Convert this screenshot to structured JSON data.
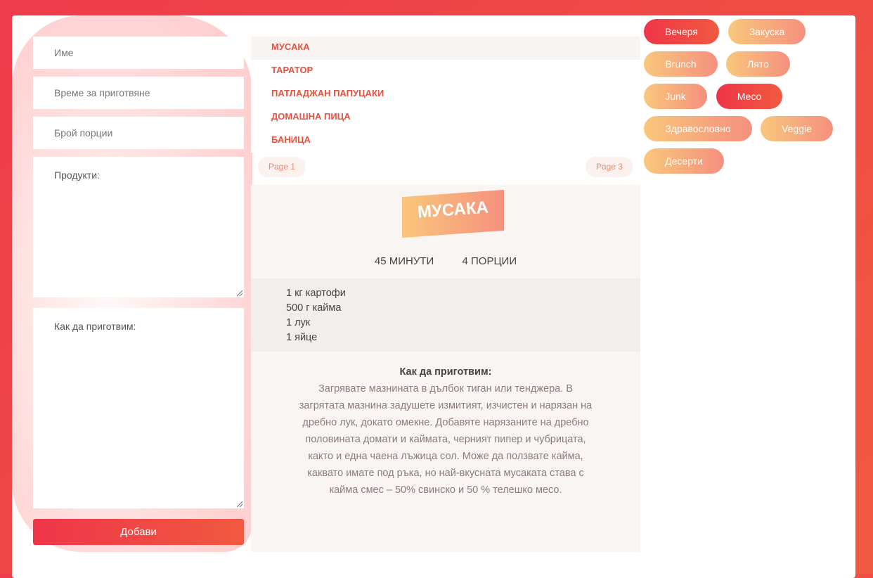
{
  "form": {
    "name_placeholder": "Име",
    "time_placeholder": "Време за приготвяне",
    "portions_placeholder": "Брой порции",
    "products_placeholder": "Продукти:",
    "howto_placeholder": "Как да приготвим:",
    "submit_label": "Добави"
  },
  "recipes": {
    "items": [
      "МУСАКА",
      "ТАРАТОР",
      "ПАТЛАДЖАН ПАПУЦАКИ",
      "ДОМАШНА ПИЦА",
      "БАНИЦА"
    ],
    "active_index": 0
  },
  "pager": {
    "prev_label": "Page 1",
    "next_label": "Page 3"
  },
  "detail": {
    "title": "МУСАКА",
    "time": "45 МИНУТИ",
    "portions": "4 ПОРЦИИ",
    "ingredients": [
      "1 кг картофи",
      "500 г кайма",
      "1 лук",
      "1 яйце"
    ],
    "howto_heading": "Как да приготвим:",
    "howto_text": "Загрявате мазнината в дълбок тиган или тенджера. В загрятата мазнина задушете измитият, изчистен и нарязан на дребно лук, докато омекне. Добавяте нарязаните на дребно половината домати и каймата, черният пипер и чубрицата, както и една чаена лъжица сол. Може да ползвате кайма, каквато имате под ръка, но най-вкусната мусаката става с кайма смес – 50% свинско и 50 % телешко месо."
  },
  "tags": [
    {
      "label": "Вечеря",
      "style": "hot"
    },
    {
      "label": "Закуска",
      "style": "warm"
    },
    {
      "label": "Brunch",
      "style": "warm"
    },
    {
      "label": "Лято",
      "style": "warm"
    },
    {
      "label": "Junk",
      "style": "warm"
    },
    {
      "label": "Месо",
      "style": "hot"
    },
    {
      "label": "Здравословно",
      "style": "warm"
    },
    {
      "label": "Veggie",
      "style": "warm"
    },
    {
      "label": "Десерти",
      "style": "warm"
    }
  ],
  "colors": {
    "accent": "#ef3b4a",
    "accent2": "#f05a40",
    "warm_start": "#f9c77c",
    "warm_end": "#f5907e"
  }
}
